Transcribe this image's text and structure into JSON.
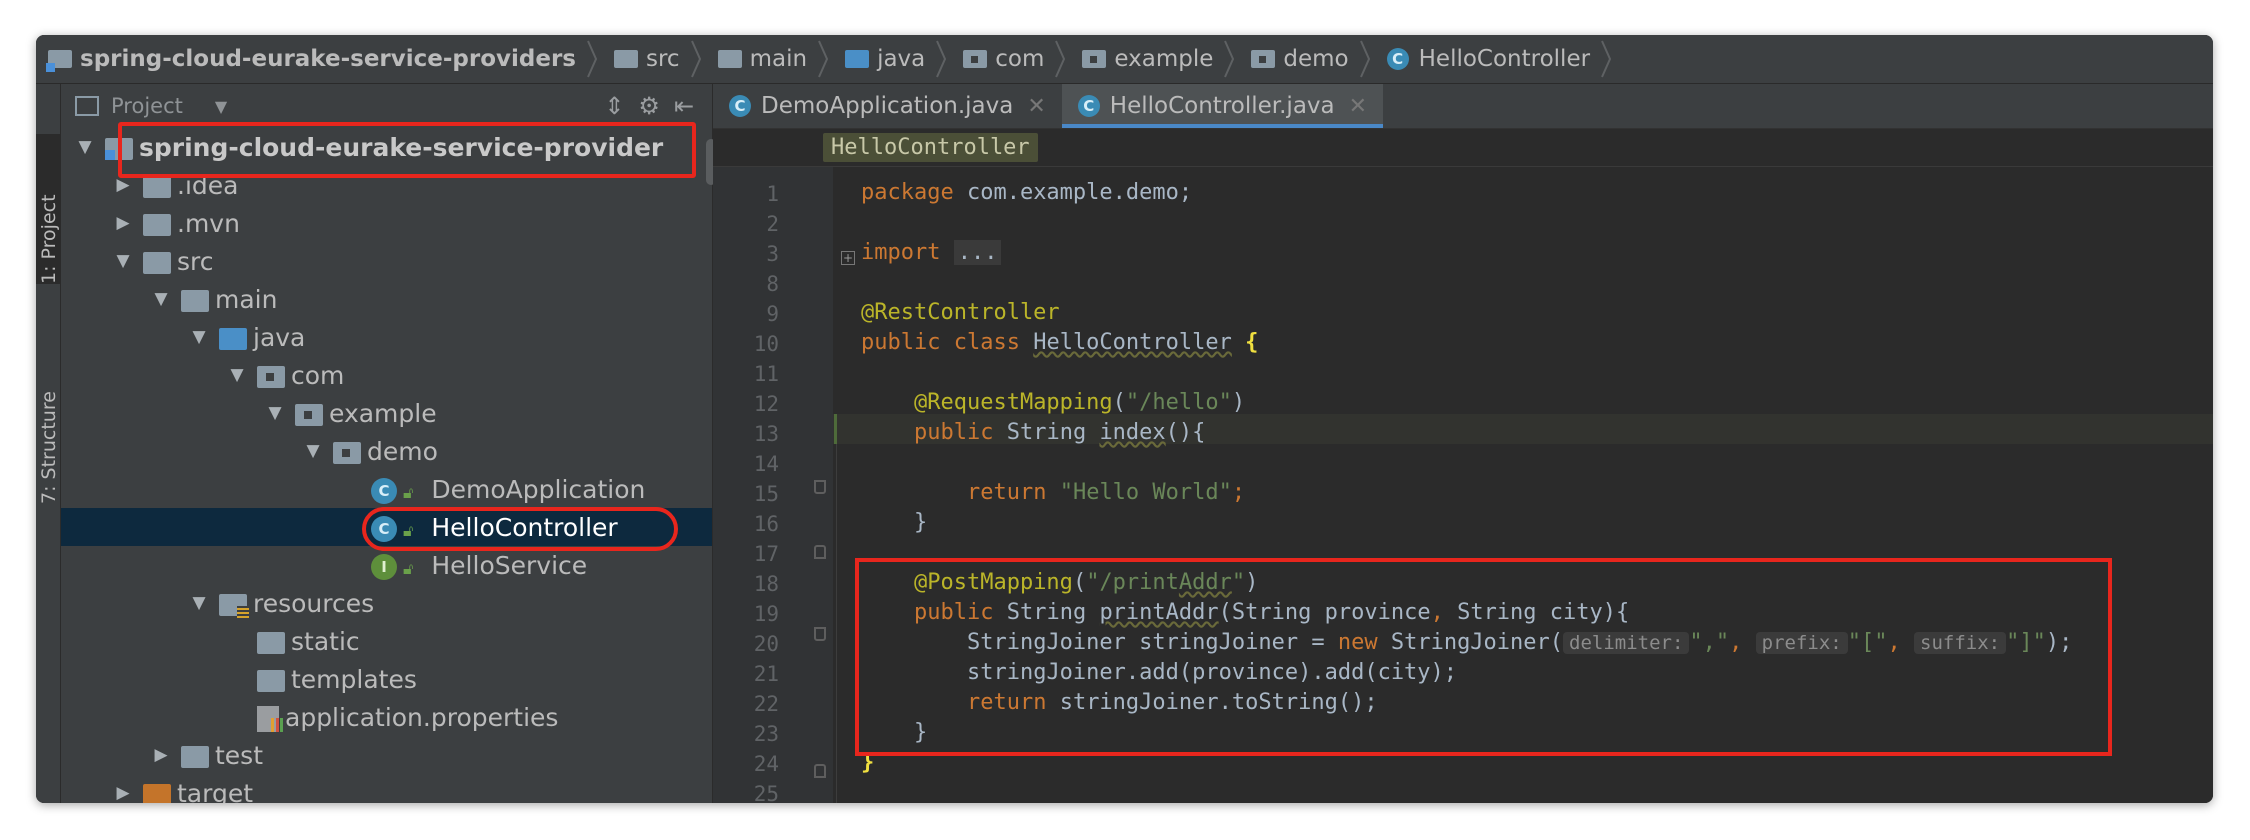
{
  "breadcrumb": [
    {
      "label": "spring-cloud-eurake-service-providers",
      "icon": "module-folder-icon"
    },
    {
      "label": "src",
      "icon": "folder-icon"
    },
    {
      "label": "main",
      "icon": "folder-icon"
    },
    {
      "label": "java",
      "icon": "source-folder-icon"
    },
    {
      "label": "com",
      "icon": "package-icon"
    },
    {
      "label": "example",
      "icon": "package-icon"
    },
    {
      "label": "demo",
      "icon": "package-icon"
    },
    {
      "label": "HelloController",
      "icon": "class-icon"
    }
  ],
  "side_tabs": {
    "project": "1: Project",
    "structure": "7: Structure"
  },
  "project_panel": {
    "title": "Project",
    "tree": [
      {
        "label": "spring-cloud-eurake-service-provider",
        "depth": 0,
        "expanded": true,
        "icon": "module-folder-icon",
        "bold": true
      },
      {
        "label": ".idea",
        "depth": 1,
        "expanded": false,
        "icon": "folder-icon"
      },
      {
        "label": ".mvn",
        "depth": 1,
        "expanded": false,
        "icon": "folder-icon"
      },
      {
        "label": "src",
        "depth": 1,
        "expanded": true,
        "icon": "folder-icon"
      },
      {
        "label": "main",
        "depth": 2,
        "expanded": true,
        "icon": "folder-icon"
      },
      {
        "label": "java",
        "depth": 3,
        "expanded": true,
        "icon": "source-folder-icon"
      },
      {
        "label": "com",
        "depth": 4,
        "expanded": true,
        "icon": "package-icon"
      },
      {
        "label": "example",
        "depth": 5,
        "expanded": true,
        "icon": "package-icon"
      },
      {
        "label": "demo",
        "depth": 6,
        "expanded": true,
        "icon": "package-icon"
      },
      {
        "label": "DemoApplication",
        "depth": 7,
        "icon": "spring-class-icon"
      },
      {
        "label": "HelloController",
        "depth": 7,
        "icon": "class-icon",
        "selected": true
      },
      {
        "label": "HelloService",
        "depth": 7,
        "icon": "interface-icon"
      },
      {
        "label": "resources",
        "depth": 3,
        "expanded": true,
        "icon": "resources-folder-icon"
      },
      {
        "label": "static",
        "depth": 4,
        "icon": "folder-icon"
      },
      {
        "label": "templates",
        "depth": 4,
        "icon": "folder-icon"
      },
      {
        "label": "application.properties",
        "depth": 4,
        "icon": "properties-file-icon"
      },
      {
        "label": "test",
        "depth": 2,
        "expanded": false,
        "icon": "folder-icon"
      },
      {
        "label": "target",
        "depth": 1,
        "expanded": false,
        "icon": "excluded-folder-icon"
      }
    ]
  },
  "editor": {
    "tabs": [
      {
        "label": "DemoApplication.java",
        "active": false
      },
      {
        "label": "HelloController.java",
        "active": true
      }
    ],
    "breadcrumb_tag": "HelloController",
    "line_numbers": [
      "1",
      "2",
      "3",
      "8",
      "9",
      "10",
      "11",
      "12",
      "13",
      "14",
      "15",
      "16",
      "17",
      "18",
      "19",
      "20",
      "21",
      "22",
      "23",
      "24",
      "25"
    ],
    "code": {
      "l1_kw": "package",
      "l1_rest": " com.example.demo;",
      "l3_kw": "import",
      "l3_ell": "...",
      "l9_an": "@RestController",
      "l10_kw": "public class",
      "l10_cls": "HelloController",
      "l10_brace": "{",
      "l12_an": "@RequestMapping",
      "l12_open": "(",
      "l12_str": "\"/hello\"",
      "l12_close": ")",
      "l13_kw": "public",
      "l13_type": " String ",
      "l13_fn": "index",
      "l13_rest": "(){",
      "l15_kw": "return",
      "l15_str": "\"Hello World\"",
      "l15_semi": ";",
      "l16": "}",
      "l18_an": "@PostMapping",
      "l18_open": "(",
      "l18_str1": "\"/print",
      "l18_str2": "Addr",
      "l18_str3": "\"",
      "l18_close": ")",
      "l19_kw": "public",
      "l19_a": " String ",
      "l19_fn": "printAddr",
      "l19_b": "(String province",
      "l19_comma": ",",
      "l19_c": " String city){",
      "l20_a": "StringJoiner stringJoiner = ",
      "l20_kw": "new",
      "l20_b": " StringJoiner(",
      "l20_h1": "delimiter:",
      "l20_s1": "\",\"",
      "l20_h2": "prefix:",
      "l20_s2": "\"[\"",
      "l20_h3": "suffix:",
      "l20_s3": "\"]\"",
      "l20_end": ");",
      "l21": "stringJoiner.add(province).add(city);",
      "l22_kw": "return",
      "l22_rest": " stringJoiner.toString();",
      "l23": "}",
      "l24": "}"
    }
  }
}
